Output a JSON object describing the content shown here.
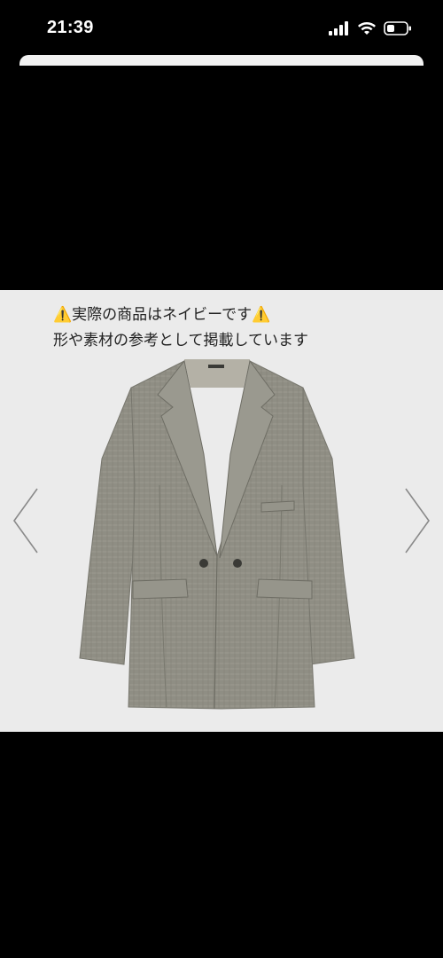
{
  "status_bar": {
    "time": "21:39",
    "icons": [
      "signal-icon",
      "wifi-icon",
      "battery-icon"
    ]
  },
  "image_viewer": {
    "caption_line1": "実際の商品はネイビーです",
    "caption_line2": "形や素材の参考として掲載しています",
    "warning_glyph": "⚠️",
    "prev_icon": "chevron-left-icon",
    "next_icon": "chevron-right-icon",
    "product_image": "gray double-breasted jacket"
  },
  "colors": {
    "background": "#000000",
    "viewer_bg": "#ebebeb",
    "jacket": "#8f8e84"
  }
}
